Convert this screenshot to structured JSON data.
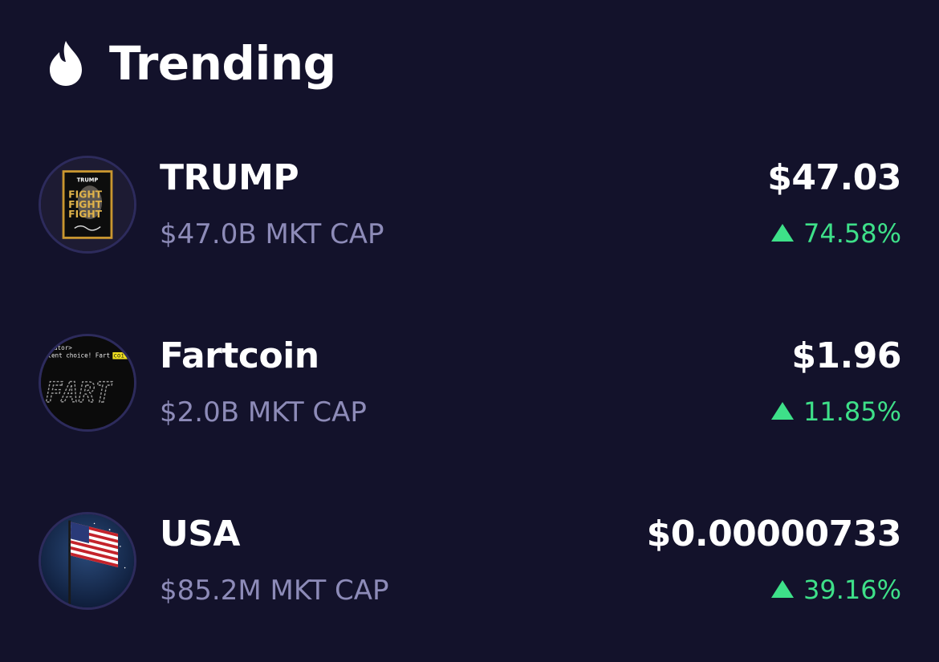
{
  "header": {
    "title": "Trending",
    "icon": "flame-icon"
  },
  "colors": {
    "background": "#13122b",
    "positive": "#3ee089",
    "muted": "#8d8bb8"
  },
  "tokens": [
    {
      "name": "TRUMP",
      "market_cap": "$47.0B MKT CAP",
      "price": "$47.03",
      "change": "74.58%",
      "direction": "up",
      "avatar_text": "TRUMP",
      "avatar_slogan": [
        "FIGHT",
        "FIGHT",
        "FIGHT"
      ]
    },
    {
      "name": "Fartcoin",
      "market_cap": "$2.0B MKT CAP",
      "price": "$1.96",
      "change": "11.85%",
      "direction": "up",
      "avatar_line1": "tutor>",
      "avatar_line2": "llent choice! Fart",
      "avatar_highlight": "coi",
      "avatar_logo": "FART"
    },
    {
      "name": "USA",
      "market_cap": "$85.2M MKT CAP",
      "price": "$0.00000733",
      "change": "39.16%",
      "direction": "up",
      "avatar_icon": "american-flag-icon"
    }
  ]
}
